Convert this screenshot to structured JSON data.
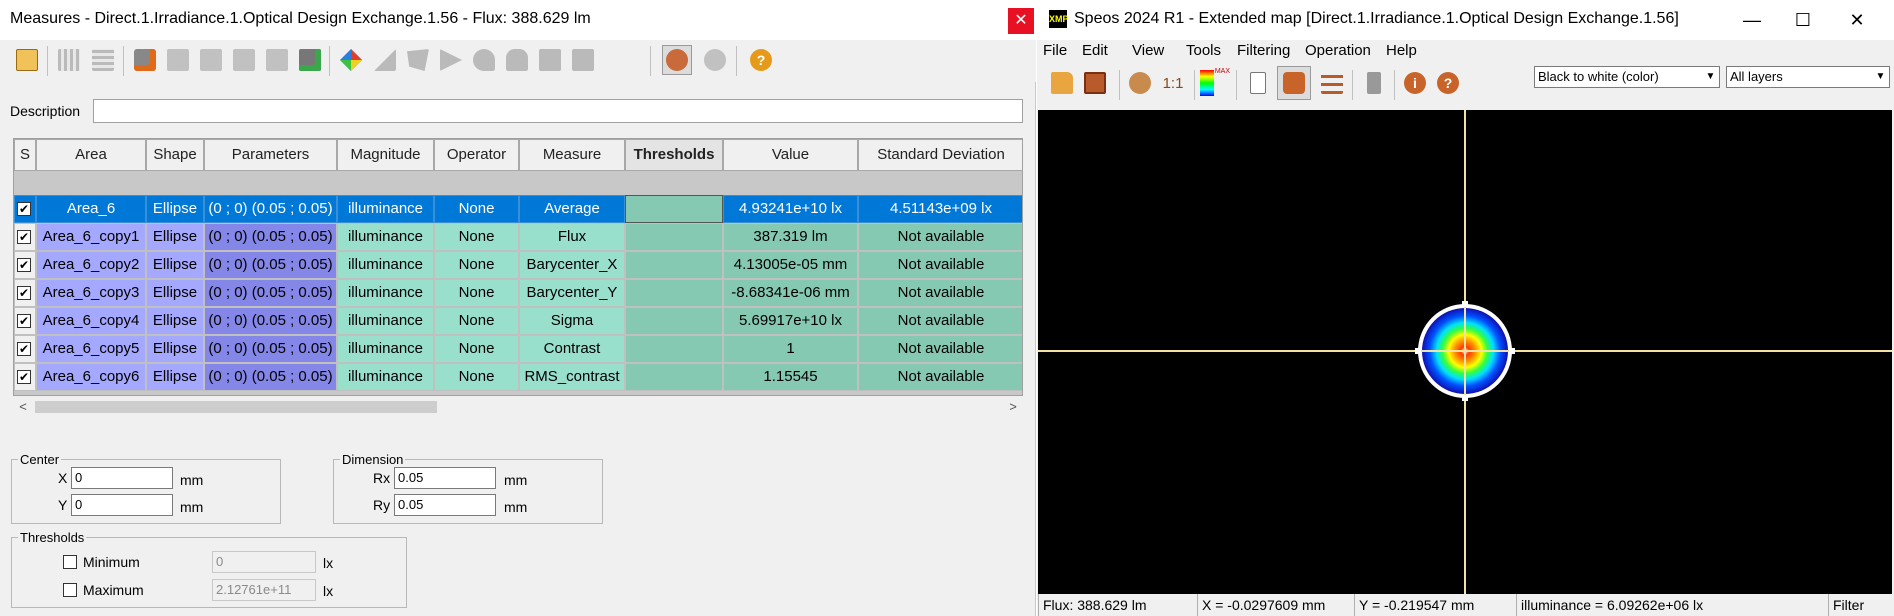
{
  "measures_window": {
    "title": "Measures - Direct.1.Irradiance.1.Optical Design Exchange.1.56 - Flux: 388.629 lm",
    "close_glyph": "✕",
    "description_label": "Description",
    "description_value": "",
    "columns": [
      "S",
      "Area",
      "Shape",
      "Parameters",
      "Magnitude",
      "Operator",
      "Measure",
      "Thresholds",
      "Value",
      "Standard Deviation"
    ],
    "rows": [
      {
        "checked": true,
        "area": "Area_6",
        "shape": "Ellipse",
        "parameters": "(0 ; 0) (0.05 ; 0.05)",
        "magnitude": "illuminance",
        "operator": "None",
        "measure": "Average",
        "thresholds": "",
        "value": "4.93241e+10 lx",
        "std": "4.51143e+09 lx"
      },
      {
        "checked": true,
        "area": "Area_6_copy1",
        "shape": "Ellipse",
        "parameters": "(0 ; 0) (0.05 ; 0.05)",
        "magnitude": "illuminance",
        "operator": "None",
        "measure": "Flux",
        "thresholds": "",
        "value": "387.319 lm",
        "std": "Not available"
      },
      {
        "checked": true,
        "area": "Area_6_copy2",
        "shape": "Ellipse",
        "parameters": "(0 ; 0) (0.05 ; 0.05)",
        "magnitude": "illuminance",
        "operator": "None",
        "measure": "Barycenter_X",
        "thresholds": "",
        "value": "4.13005e-05 mm",
        "std": "Not available"
      },
      {
        "checked": true,
        "area": "Area_6_copy3",
        "shape": "Ellipse",
        "parameters": "(0 ; 0) (0.05 ; 0.05)",
        "magnitude": "illuminance",
        "operator": "None",
        "measure": "Barycenter_Y",
        "thresholds": "",
        "value": "-8.68341e-06 mm",
        "std": "Not available"
      },
      {
        "checked": true,
        "area": "Area_6_copy4",
        "shape": "Ellipse",
        "parameters": "(0 ; 0) (0.05 ; 0.05)",
        "magnitude": "illuminance",
        "operator": "None",
        "measure": "Sigma",
        "thresholds": "",
        "value": "5.69917e+10 lx",
        "std": "Not available"
      },
      {
        "checked": true,
        "area": "Area_6_copy5",
        "shape": "Ellipse",
        "parameters": "(0 ; 0) (0.05 ; 0.05)",
        "magnitude": "illuminance",
        "operator": "None",
        "measure": "Contrast",
        "thresholds": "",
        "value": "1",
        "std": "Not available"
      },
      {
        "checked": true,
        "area": "Area_6_copy6",
        "shape": "Ellipse",
        "parameters": "(0 ; 0) (0.05 ; 0.05)",
        "magnitude": "illuminance",
        "operator": "None",
        "measure": "RMS_contrast",
        "thresholds": "",
        "value": "1.15545",
        "std": "Not available"
      }
    ],
    "selected_row": 0,
    "center": {
      "legend": "Center",
      "x_label": "X",
      "x_value": "0",
      "y_label": "Y",
      "y_value": "0",
      "unit": "mm"
    },
    "dimension": {
      "legend": "Dimension",
      "rx_label": "Rx",
      "rx_value": "0.05",
      "ry_label": "Ry",
      "ry_value": "0.05",
      "unit": "mm"
    },
    "thresholds": {
      "legend": "Thresholds",
      "min_label": "Minimum",
      "min_value": "0",
      "max_label": "Maximum",
      "max_value": "2.12761e+11",
      "unit": "lx"
    },
    "toolbar_icons": [
      "import-icon",
      "grid-icon",
      "grid-remove-icon",
      "add-area-icon",
      "remove-area-icon",
      "move-up-icon",
      "move-down-icon",
      "fit-icon",
      "add-measure-icon",
      "color-scale-icon",
      "rectangle-shape-icon",
      "polygon-shape-icon",
      "sector-shape-icon",
      "ellipse-shape-icon",
      "hole-shape-icon",
      "square-shape-icon",
      "camera-icon",
      "globe-icon",
      "help-icon"
    ]
  },
  "speos_window": {
    "logo_text": "XMP",
    "title": "Speos 2024 R1 - Extended map [Direct.1.Irradiance.1.Optical Design Exchange.1.56]",
    "menu": [
      "File",
      "Edit",
      "View",
      "Tools",
      "Filtering",
      "Operation",
      "Help"
    ],
    "toolbar": {
      "ratio_label": "1:1",
      "max_label": "MAX"
    },
    "color_mode": "Black to white (color)",
    "layers": "All layers",
    "status": {
      "flux": "Flux: 388.629 lm",
      "x": "X = -0.0297609 mm",
      "y": "Y = -0.219547 mm",
      "value": "illuminance = 6.09262e+06 lx",
      "filter": "Filter"
    },
    "colors": {
      "crosshair": "#f2e3a0",
      "ring": "#ffffff",
      "background": "#000000"
    }
  }
}
